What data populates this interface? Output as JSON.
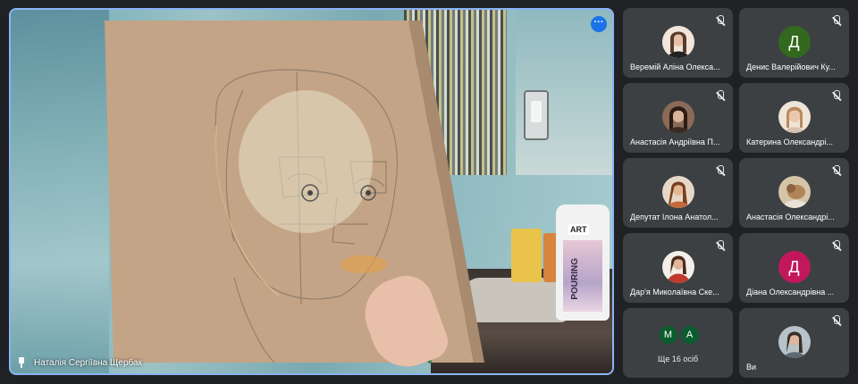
{
  "presenter": {
    "name": "Наталія Сергіївна Щербак"
  },
  "stage": {
    "bottle_label": "ART",
    "bottle_text": "POURING",
    "more_icon": "more-options-icon"
  },
  "participants": [
    {
      "name": "Веремій Аліна Олекса...",
      "avatar_type": "photo",
      "avatar_color": "#c8a690"
    },
    {
      "name": "Денис Валерійович Ку...",
      "avatar_type": "letter",
      "letter": "Д",
      "avatar_color": "#33691e"
    },
    {
      "name": "Анастасія Андріївна П...",
      "avatar_type": "photo",
      "avatar_color": "#6b4c3b"
    },
    {
      "name": "Катерина Олександрі...",
      "avatar_type": "photo",
      "avatar_color": "#d9b59d"
    },
    {
      "name": "Депутат Ілона Анатол...",
      "avatar_type": "photo",
      "avatar_color": "#a86a44"
    },
    {
      "name": "Анастасія Олександрі...",
      "avatar_type": "photo",
      "avatar_color": "#d4c0a6"
    },
    {
      "name": "Дар'я Миколаївна Ске...",
      "avatar_type": "photo",
      "avatar_color": "#c0392b"
    },
    {
      "name": "Діана Олександрівна ...",
      "avatar_type": "letter",
      "letter": "Д",
      "avatar_color": "#c2185b"
    }
  ],
  "others": {
    "label": "Ще 16 осіб",
    "letters": [
      "М",
      "А"
    ],
    "color": "#0b5c2e"
  },
  "self": {
    "name": "Ви",
    "avatar_color": "#9aa6b0"
  }
}
